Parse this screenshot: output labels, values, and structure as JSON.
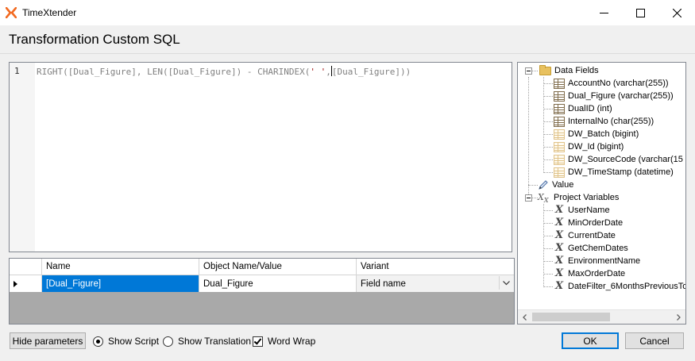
{
  "window": {
    "app_title": "TimeXtender",
    "minimize_icon": "minimize-icon",
    "maximize_icon": "maximize-icon",
    "close_icon": "close-icon"
  },
  "dialog": {
    "heading": "Transformation Custom SQL"
  },
  "editor": {
    "line_number": "1",
    "code_before": "RIGHT([Dual_Figure], LEN([Dual_Figure]) - CHARINDEX(",
    "code_string": "' '",
    "code_after_comma": ",",
    "code_after_caret": "[Dual_Figure]))"
  },
  "parameters_grid": {
    "columns": [
      "Name",
      "Object Name/Value",
      "Variant"
    ],
    "rows": [
      {
        "name": "[Dual_Figure]",
        "value": "Dual_Figure",
        "variant": "Field name"
      }
    ]
  },
  "tree": {
    "data_fields": {
      "label": "Data Fields",
      "icon": "folder-icon",
      "items": [
        {
          "label": "AccountNo (varchar(255))",
          "icon": "field-icon"
        },
        {
          "label": "Dual_Figure (varchar(255))",
          "icon": "field-icon"
        },
        {
          "label": "DualID (int)",
          "icon": "field-icon"
        },
        {
          "label": "InternalNo (char(255))",
          "icon": "field-icon"
        },
        {
          "label": "DW_Batch (bigint)",
          "icon": "system-field-icon"
        },
        {
          "label": "DW_Id (bigint)",
          "icon": "system-field-icon"
        },
        {
          "label": "DW_SourceCode (varchar(15",
          "icon": "system-field-icon"
        },
        {
          "label": "DW_TimeStamp (datetime)",
          "icon": "system-field-icon"
        }
      ]
    },
    "value": {
      "label": "Value",
      "icon": "pencil-icon"
    },
    "project_variables": {
      "label": "Project Variables",
      "icon": "variables-icon",
      "items": [
        {
          "label": "UserName",
          "icon": "variable-icon"
        },
        {
          "label": "MinOrderDate",
          "icon": "variable-icon"
        },
        {
          "label": "CurrentDate",
          "icon": "variable-icon"
        },
        {
          "label": "GetChemDates",
          "icon": "variable-icon"
        },
        {
          "label": "EnvironmentName",
          "icon": "variable-icon"
        },
        {
          "label": "MaxOrderDate",
          "icon": "variable-icon"
        },
        {
          "label": "DateFilter_6MonthsPreviousTo",
          "icon": "variable-icon"
        }
      ]
    }
  },
  "footer": {
    "hide_parameters": "Hide parameters",
    "show_script": "Show Script",
    "show_translation": "Show Translation",
    "word_wrap": "Word Wrap",
    "ok": "OK",
    "cancel": "Cancel"
  },
  "colors": {
    "accent": "#0078d7",
    "logo_orange": "#f26a21"
  }
}
